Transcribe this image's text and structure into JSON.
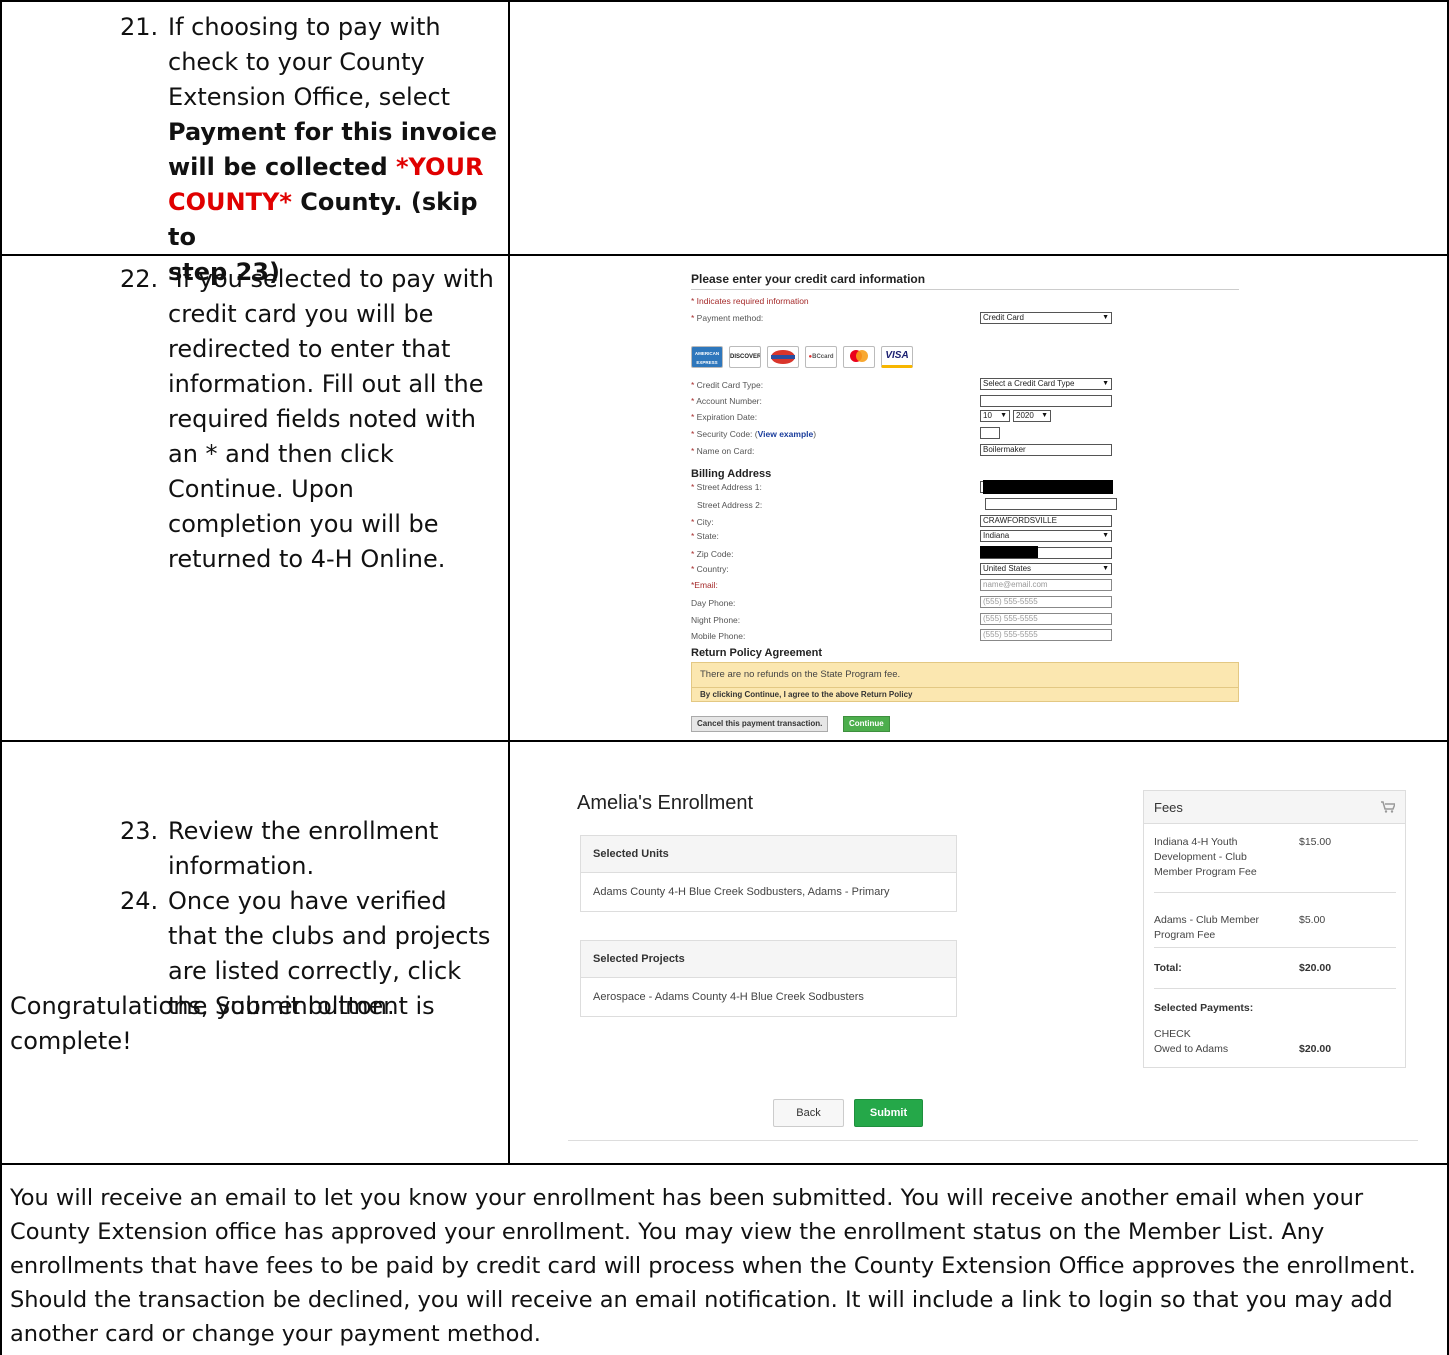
{
  "step21": {
    "number": "21.",
    "line1": "If choosing to pay with",
    "line2": "check to your County",
    "line3": "Extension Office, select",
    "bold1": "Payment for this invoice",
    "bold2a": "will be collected ",
    "red1": "*YOUR",
    "red2": "COUNTY*",
    "bold3b": " County. (skip to",
    "bold4": "step 23)"
  },
  "step22": {
    "number": "22.",
    "lines": [
      " If you selected to pay with",
      "credit card you will be",
      "redirected to enter that",
      "information. Fill out all the",
      "required fields noted with",
      "an * and then click",
      "Continue. Upon",
      "completion you will be",
      "returned to 4-H Online."
    ]
  },
  "cc_form": {
    "title": "Please enter your credit card information",
    "required_note": "* Indicates required information",
    "payment_method_label": "Payment method:",
    "payment_method_value": "Credit Card",
    "card_logos": [
      "AMERICAN EXPRESS",
      "DISCOVER",
      "MasterCard",
      "BCcard",
      "mastercard",
      "VISA"
    ],
    "card_type_label": "Credit Card Type:",
    "card_type_value": "Select a Credit Card Type",
    "account_label": "Account Number:",
    "expiration_label": "Expiration Date:",
    "exp_month": "10",
    "exp_year": "2020",
    "security_label": "Security Code: (",
    "security_link": "View example",
    "security_close": ")",
    "name_label": "Name on Card:",
    "name_value": "Boilermaker",
    "billing_heading": "Billing Address",
    "street1_label": "Street Address 1:",
    "street2_label": "Street Address 2:",
    "city_label": "City:",
    "city_value": "CRAWFORDSVILLE",
    "state_label": "State:",
    "state_value": "Indiana",
    "zip_label": "Zip Code:",
    "country_label": "Country:",
    "country_value": "United States",
    "email_label": "*Email:",
    "email_placeholder": "name@email.com",
    "day_phone_label": "Day Phone:",
    "night_phone_label": "Night Phone:",
    "mobile_phone_label": "Mobile Phone:",
    "phone_placeholder": "(555) 555-5555",
    "policy_heading": "Return Policy Agreement",
    "policy_text": "There are no refunds on the State Program fee.",
    "policy_agree": "By clicking Continue, I agree to the above Return Policy",
    "cancel_button": "Cancel this payment transaction.",
    "continue_button": "Continue"
  },
  "step23": {
    "num23": "23.",
    "text23a": "Review the enrollment",
    "text23b": "information.",
    "num24": "24.",
    "text24": [
      "Once you have verified",
      "that the clubs and projects",
      "are listed correctly, click",
      "the Submit button."
    ],
    "congrats1": "Congratulations, your enrollment is",
    "congrats2": "complete!"
  },
  "enrollment": {
    "title": "Amelia's Enrollment",
    "units_heading": "Selected Units",
    "unit_value": "Adams County 4-H Blue Creek Sodbusters, Adams - Primary",
    "projects_heading": "Selected Projects",
    "project_value": "Aerospace - Adams County 4-H Blue Creek Sodbusters",
    "fees_heading": "Fees",
    "fee1_name": [
      "Indiana 4-H Youth",
      "Development - Club",
      "Member Program Fee"
    ],
    "fee1_amount": "$15.00",
    "fee2_name": [
      "Adams - Club Member",
      "Program Fee"
    ],
    "fee2_amount": "$5.00",
    "total_label": "Total:",
    "total_amount": "$20.00",
    "payments_label": "Selected Payments:",
    "payment_type": "CHECK",
    "owed_label": "Owed to Adams",
    "owed_amount": "$20.00",
    "back_button": "Back",
    "submit_button": "Submit"
  },
  "footer": {
    "paragraph": "You will receive an email to let you know your enrollment has been submitted. You will receive another email when your County Extension office has approved your enrollment.  You may view the enrollment status on the Member List.  Any enrollments that have fees to be paid by credit card will process when the County Extension Office approves the enrollment. Should the transaction be declined, you will receive an email notification. It will include a link to login so that you may add another card or change your payment method."
  }
}
